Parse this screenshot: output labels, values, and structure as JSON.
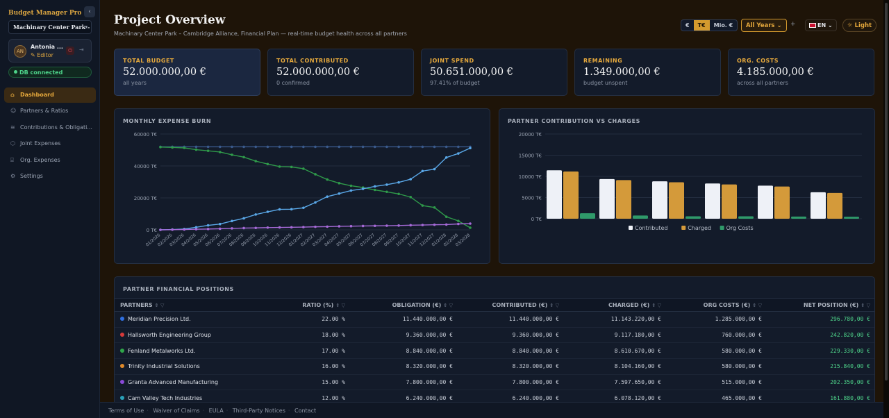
{
  "sidebar": {
    "brand": "Budget Manager Pro",
    "project": "Machinary Center Park - ...",
    "user": {
      "initials": "AN",
      "name": "Antonia ...",
      "role": "Editor"
    },
    "db_status": "DB connected",
    "nav": [
      {
        "label": "Dashboard",
        "icon": "home-icon"
      },
      {
        "label": "Partners & Ratios",
        "icon": "users-icon"
      },
      {
        "label": "Contributions & Obligati...",
        "icon": "layers-icon"
      },
      {
        "label": "Joint Expenses",
        "icon": "hexagon-icon"
      },
      {
        "label": "Org. Expenses",
        "icon": "building-icon"
      },
      {
        "label": "Settings",
        "icon": "gear-icon"
      }
    ]
  },
  "header": {
    "title": "Project Overview",
    "subtitle": "Machinary Center Park – Cambridge Alliance, Financial Plan — real-time budget health across all partners",
    "units": [
      "€",
      "T€",
      "Mio. €"
    ],
    "active_unit": "T€",
    "year_filter": "All Years",
    "plus": "+",
    "language": "EN",
    "theme": "Light"
  },
  "kpis": [
    {
      "label": "TOTAL BUDGET",
      "value": "52.000.000,00 €",
      "sub": "all years"
    },
    {
      "label": "TOTAL CONTRIBUTED",
      "value": "52.000.000,00 €",
      "sub": "0 confirmed"
    },
    {
      "label": "JOINT SPEND",
      "value": "50.651.000,00 €",
      "sub": "97.41% of budget"
    },
    {
      "label": "REMAINING",
      "value": "1.349.000,00 €",
      "sub": "budget unspent"
    },
    {
      "label": "ORG. COSTS",
      "value": "4.185.000,00 €",
      "sub": "across all partners"
    }
  ],
  "burn_title": "MONTHLY EXPENSE BURN",
  "bar_title": "PARTNER CONTRIBUTION VS CHARGES",
  "chart_data": [
    {
      "type": "line",
      "title": "MONTHLY EXPENSE BURN",
      "x": [
        "01/2026",
        "02/2026",
        "03/2026",
        "04/2026",
        "05/2026",
        "06/2026",
        "07/2026",
        "08/2026",
        "09/2026",
        "10/2026",
        "11/2026",
        "12/2026",
        "01/2027",
        "02/2027",
        "03/2027",
        "04/2027",
        "05/2027",
        "06/2027",
        "07/2027",
        "08/2027",
        "09/2027",
        "10/2027",
        "11/2027",
        "12/2027",
        "01/2028",
        "02/2028",
        "03/2028"
      ],
      "ylim": [
        0,
        60000
      ],
      "yticks": [
        "0 T€",
        "20000 T€",
        "40000 T€",
        "60000 T€"
      ],
      "grid": true,
      "series": [
        {
          "color": "#3a5a8c",
          "values": [
            52000,
            52000,
            52000,
            52000,
            52000,
            52000,
            52000,
            52000,
            52000,
            52000,
            52000,
            52000,
            52000,
            52000,
            52000,
            52000,
            52000,
            52000,
            52000,
            52000,
            52000,
            52000,
            52000,
            52000,
            52000,
            52000,
            52000
          ]
        },
        {
          "color": "#2f9a4a",
          "values": [
            51800,
            51600,
            51300,
            50200,
            49500,
            48700,
            47000,
            45500,
            43000,
            41200,
            39600,
            39400,
            38300,
            34800,
            31500,
            29200,
            27600,
            26500,
            25000,
            23800,
            22500,
            20500,
            15200,
            14000,
            8200,
            5600,
            1300
          ]
        },
        {
          "color": "#5aa8e8",
          "values": [
            0,
            200,
            500,
            1600,
            2800,
            3600,
            5500,
            7200,
            9600,
            11300,
            12800,
            12900,
            13800,
            17100,
            20800,
            22700,
            24600,
            25700,
            27200,
            28300,
            29700,
            31700,
            36800,
            38000,
            45300,
            47800,
            51200
          ]
        },
        {
          "color": "#a66ad8",
          "values": [
            0,
            100,
            200,
            400,
            500,
            700,
            900,
            1100,
            1200,
            1400,
            1500,
            1600,
            1700,
            1900,
            2000,
            2200,
            2300,
            2400,
            2500,
            2600,
            2700,
            2900,
            3000,
            3200,
            3300,
            3700,
            3900
          ]
        }
      ]
    },
    {
      "type": "bar",
      "title": "PARTNER CONTRIBUTION VS CHARGES",
      "categories": [
        "Meridian Precision Ltd.",
        "Hallsworth Engineering Group",
        "Fenland Metalworks Ltd.",
        "Trinity Industrial Solutions",
        "Granta Advanced Manufacturing",
        "Cam Valley Tech Industries"
      ],
      "ylim": [
        0,
        20000
      ],
      "yticks": [
        "0 T€",
        "5000 T€",
        "10000 T€",
        "15000 T€",
        "20000 T€"
      ],
      "legend_position": "bottom",
      "series": [
        {
          "name": "Contributed",
          "color": "#eef1f7",
          "values": [
            11440,
            9360,
            8840,
            8320,
            7800,
            6240
          ]
        },
        {
          "name": "Charged",
          "color": "#d49a3a",
          "values": [
            11143.22,
            9117.18,
            8610.67,
            8104.16,
            7597.65,
            6078.12
          ]
        },
        {
          "name": "Org Costs",
          "color": "#2f9a6a",
          "values": [
            1285,
            760,
            580,
            580,
            515,
            465
          ]
        }
      ]
    }
  ],
  "table": {
    "title": "PARTNER FINANCIAL POSITIONS",
    "columns": [
      "PARTNERS",
      "RATIO (%)",
      "OBLIGATION (€)",
      "CONTRIBUTED (€)",
      "CHARGED (€)",
      "ORG COSTS (€)",
      "NET POSITION (€)"
    ],
    "rows": [
      {
        "color": "#2f6fe0",
        "cells": [
          "Meridian Precision Ltd.",
          "22.00 %",
          "11.440.000,00 €",
          "11.440.000,00 €",
          "11.143.220,00 €",
          "1.285.000,00 €",
          "296.780,00 €"
        ]
      },
      {
        "color": "#d63a3a",
        "cells": [
          "Hallsworth Engineering Group",
          "18.00 %",
          "9.360.000,00 €",
          "9.360.000,00 €",
          "9.117.180,00 €",
          "760.000,00 €",
          "242.820,00 €"
        ]
      },
      {
        "color": "#2fa64a",
        "cells": [
          "Fenland Metalworks Ltd.",
          "17.00 %",
          "8.840.000,00 €",
          "8.840.000,00 €",
          "8.610.670,00 €",
          "580.000,00 €",
          "229.330,00 €"
        ]
      },
      {
        "color": "#e08a2a",
        "cells": [
          "Trinity Industrial Solutions",
          "16.00 %",
          "8.320.000,00 €",
          "8.320.000,00 €",
          "8.104.160,00 €",
          "580.000,00 €",
          "215.840,00 €"
        ]
      },
      {
        "color": "#8a4ad8",
        "cells": [
          "Granta Advanced Manufacturing",
          "15.00 %",
          "7.800.000,00 €",
          "7.800.000,00 €",
          "7.597.650,00 €",
          "515.000,00 €",
          "202.350,00 €"
        ]
      },
      {
        "color": "#2aa0b8",
        "cells": [
          "Cam Valley Tech Industries",
          "12.00 %",
          "6.240.000,00 €",
          "6.240.000,00 €",
          "6.078.120,00 €",
          "465.000,00 €",
          "161.880,00 €"
        ]
      }
    ]
  },
  "footer": [
    "Terms of Use",
    "Waiver of Claims",
    "EULA",
    "Third-Party Notices",
    "Contact"
  ]
}
